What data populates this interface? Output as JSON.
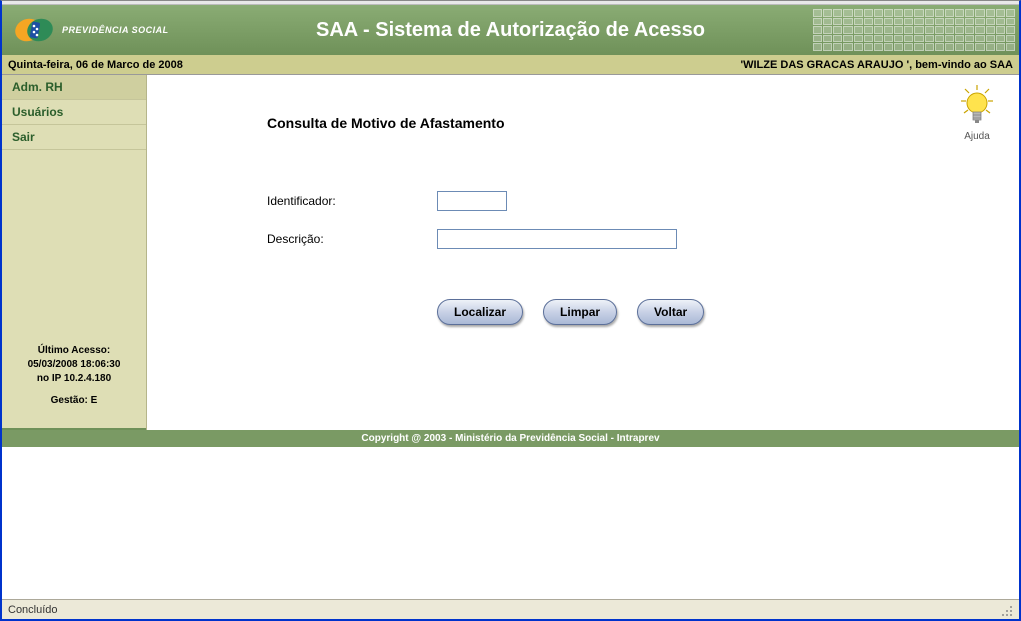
{
  "header": {
    "logo_text": "PREVIDÊNCIA SOCIAL",
    "title": "SAA - Sistema de Autorização de Acesso"
  },
  "infobar": {
    "date": "Quinta-feira, 06 de Marco de 2008",
    "welcome": "'WILZE DAS GRACAS ARAUJO ', bem-vindo ao SAA"
  },
  "sidebar": {
    "items": [
      {
        "label": "Adm. RH"
      },
      {
        "label": "Usuários"
      },
      {
        "label": "Sair"
      }
    ],
    "last_access_label": "Último Acesso:",
    "last_access_value": "05/03/2008 18:06:30",
    "last_access_ip": "no IP 10.2.4.180",
    "gestao": "Gestão: E"
  },
  "content": {
    "page_title": "Consulta de Motivo de Afastamento",
    "help_label": "Ajuda",
    "fields": {
      "identificador_label": "Identificador:",
      "identificador_value": "",
      "descricao_label": "Descrição:",
      "descricao_value": ""
    },
    "buttons": {
      "localizar": "Localizar",
      "limpar": "Limpar",
      "voltar": "Voltar"
    }
  },
  "footer": {
    "text": "Copyright @ 2003 - Ministério da Previdência Social - Intraprev"
  },
  "statusbar": {
    "text": "Concluído"
  }
}
